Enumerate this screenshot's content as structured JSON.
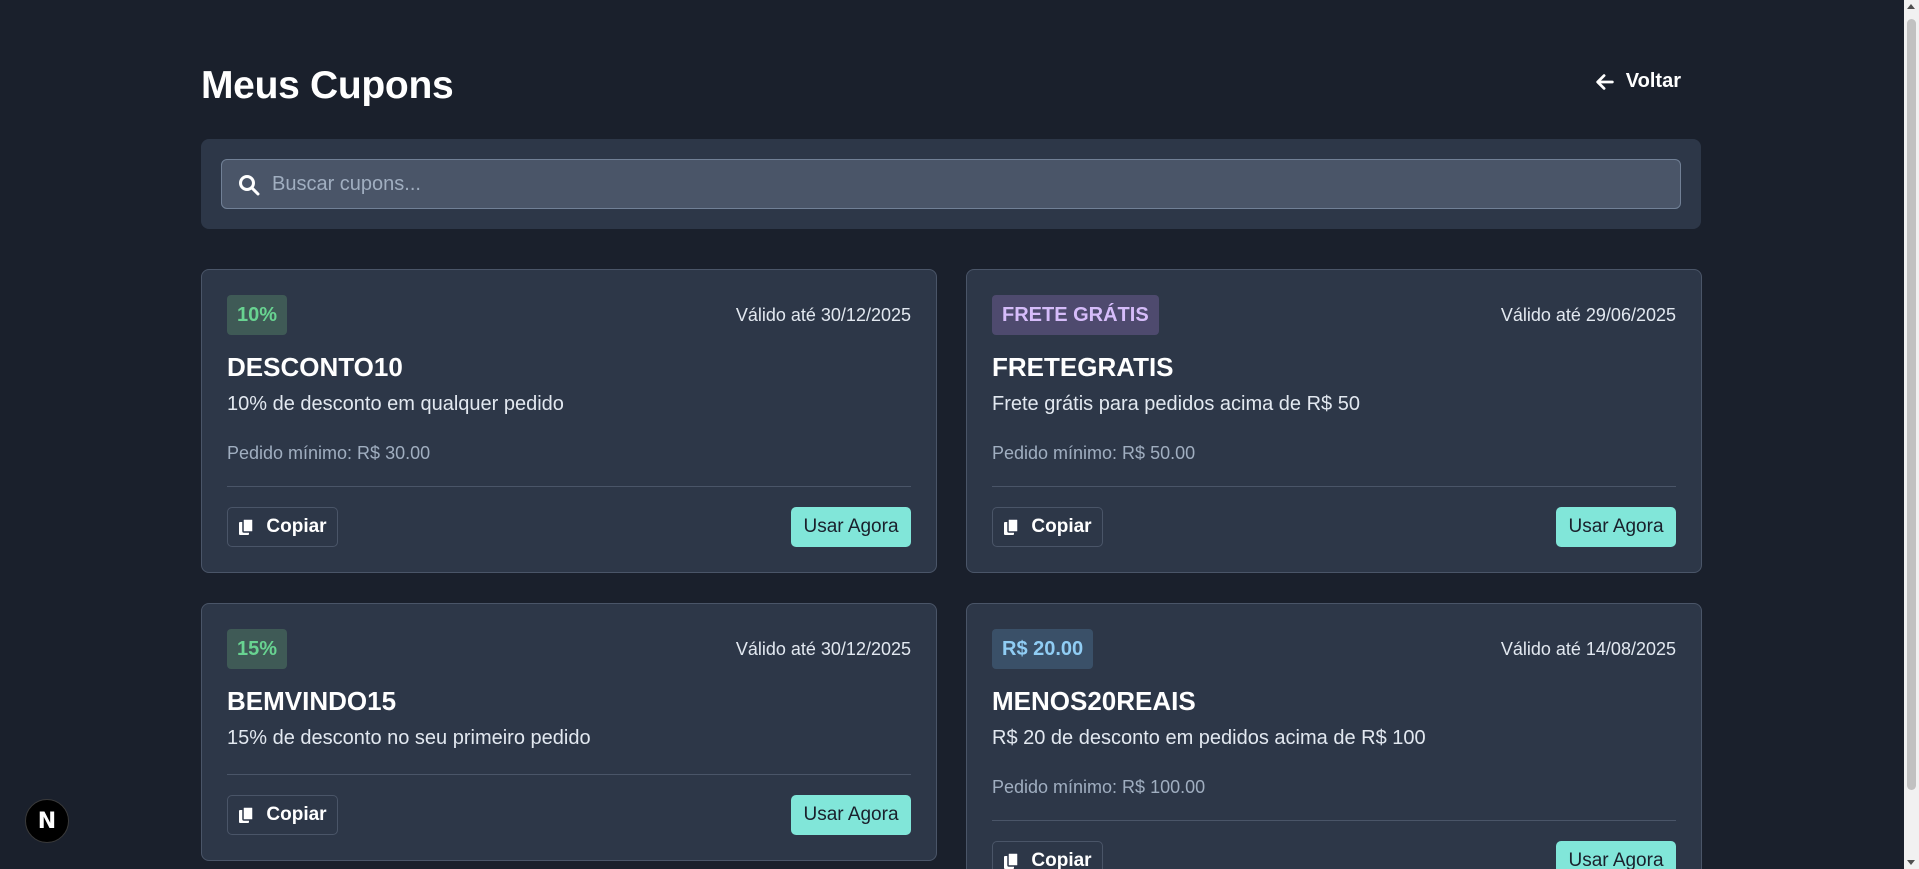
{
  "header": {
    "title": "Meus Cupons",
    "back_label": "Voltar"
  },
  "search": {
    "placeholder": "Buscar cupons..."
  },
  "coupons": [
    {
      "badge": "10%",
      "valid_until": "Válido até 30/12/2025",
      "code": "DESCONTO10",
      "description": "10% de desconto em qualquer pedido",
      "minimum": "Pedido mínimo: R$ 30.00",
      "copy_label": "Copiar",
      "use_label": "Usar Agora"
    },
    {
      "badge": "FRETE GRÁTIS",
      "valid_until": "Válido até 29/06/2025",
      "code": "FRETEGRATIS",
      "description": "Frete grátis para pedidos acima de R$ 50",
      "minimum": "Pedido mínimo: R$ 50.00",
      "copy_label": "Copiar",
      "use_label": "Usar Agora"
    },
    {
      "badge": "15%",
      "valid_until": "Válido até 30/12/2025",
      "code": "BEMVINDO15",
      "description": "15% de desconto no seu primeiro pedido",
      "copy_label": "Copiar",
      "use_label": "Usar Agora"
    },
    {
      "badge": "R$ 20.00",
      "valid_until": "Válido até 14/08/2025",
      "code": "MENOS20REAIS",
      "description": "R$ 20 de desconto em pedidos acima de R$ 100",
      "minimum": "Pedido mínimo: R$ 100.00",
      "copy_label": "Copiar",
      "use_label": "Usar Agora"
    }
  ],
  "dev_badge": "N"
}
